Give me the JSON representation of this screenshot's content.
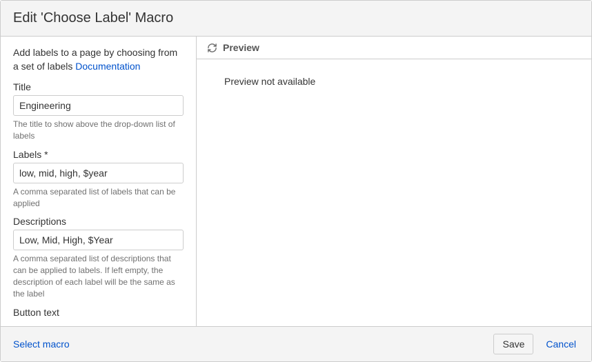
{
  "header": {
    "title": "Edit 'Choose Label' Macro"
  },
  "form": {
    "intro_text": "Add labels to a page by choosing from a set of labels ",
    "doc_link_text": "Documentation",
    "fields": {
      "title": {
        "label": "Title",
        "value": "Engineering",
        "help": "The title to show above the drop-down list of labels"
      },
      "labels": {
        "label": "Labels *",
        "value": "low, mid, high, $year",
        "help": "A comma separated list of labels that can be applied"
      },
      "descriptions": {
        "label": "Descriptions",
        "value": "Low, Mid, High, $Year",
        "help": "A comma separated list of descriptions that can be applied to labels. If left empty, the description of each label will be the same as the label"
      },
      "button_text": {
        "label": "Button text"
      }
    }
  },
  "preview": {
    "heading": "Preview",
    "body": "Preview not available"
  },
  "footer": {
    "select_macro": "Select macro",
    "save": "Save",
    "cancel": "Cancel"
  }
}
